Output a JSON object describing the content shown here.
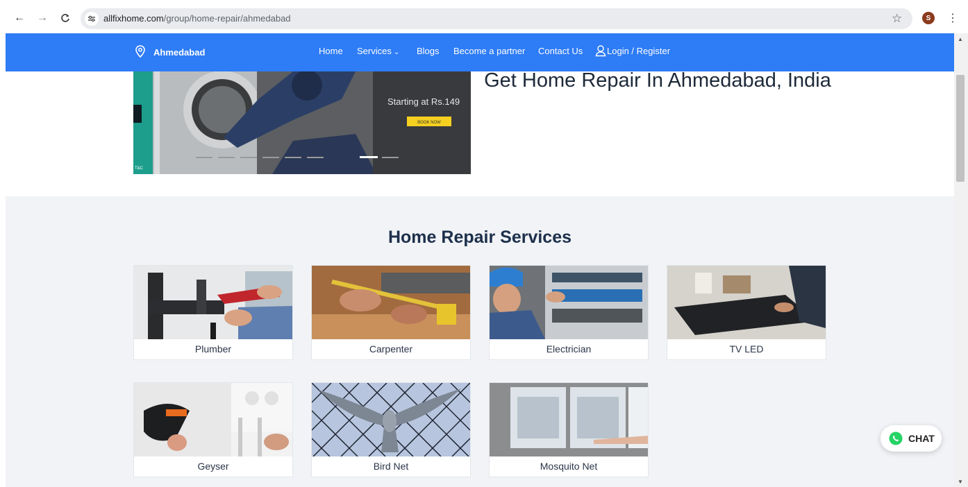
{
  "browser": {
    "url_domain": "allfixhome.com",
    "url_path": "/group/home-repair/ahmedabad",
    "profile_initial": "S",
    "icons": [
      "back-arrow-icon",
      "forward-arrow-icon",
      "reload-icon",
      "site-info-icon",
      "star-icon",
      "kebab-menu-icon"
    ]
  },
  "header": {
    "location": "Ahmedabad",
    "menu": [
      {
        "label": "Home"
      },
      {
        "label": "Services"
      },
      {
        "label": "Blogs"
      },
      {
        "label": "Become a partner"
      },
      {
        "label": "Contact Us"
      },
      {
        "label": "Login / Register"
      }
    ],
    "color": "#2e7cf6"
  },
  "hero": {
    "title": "Get Home Repair In Ahmedabad, India",
    "banner_text": "Starting at Rs.149",
    "banner_button": "BOOK NOW",
    "banner_corner": "T&C",
    "carousel_dots": 8,
    "carousel_active": 6
  },
  "services": {
    "title": "Home Repair Services",
    "items": [
      {
        "label": "Plumber"
      },
      {
        "label": "Carpenter"
      },
      {
        "label": "Electrician"
      },
      {
        "label": "TV LED"
      },
      {
        "label": "Geyser"
      },
      {
        "label": "Bird Net"
      },
      {
        "label": "Mosquito Net"
      }
    ]
  },
  "chat": {
    "label": "CHAT",
    "color": "#25d366"
  }
}
